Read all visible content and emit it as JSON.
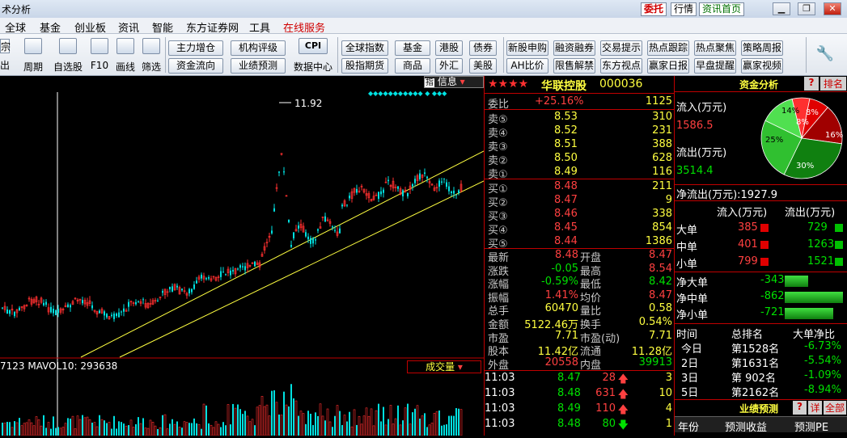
{
  "window": {
    "title": "术分析",
    "btn_trade": "委托",
    "btn_info": "行情",
    "btn_home": "资讯首页"
  },
  "menu": [
    "全球",
    "基金",
    "创业板",
    "资讯",
    "智能",
    "东方证券网",
    "工具",
    "在线服务"
  ],
  "toolbar": {
    "left_edge": [
      "宗",
      "出"
    ],
    "icons": [
      "周期",
      "自选股",
      "F10",
      "画线",
      "筛选"
    ],
    "group1": [
      "主力增仓",
      "资金流向",
      "机构评级",
      "业绩预测"
    ],
    "cpi": "CPI",
    "cpi_label": "数据中心",
    "group2": [
      "全球指数",
      "股指期货",
      "基金",
      "商品",
      "港股",
      "外汇",
      "债券",
      "美股"
    ],
    "group3": [
      "新股申购",
      "融资融券",
      "交易提示",
      "热点跟踪",
      "热点聚焦",
      "策略周报",
      "AH比价",
      "限售解禁",
      "东方视点",
      "赢家日报",
      "早盘提醒",
      "赢家视频"
    ]
  },
  "chart": {
    "peak_label": "11.92",
    "info_btn": "信息",
    "vol_label": "7123  MAVOL10: 293638",
    "vol_btn": "成交量"
  },
  "quote": {
    "stars": "★★★★",
    "name": "华联控股",
    "code": "000036",
    "weibi": {
      "label": "委比",
      "pct": "+25.16%",
      "val": "1125"
    },
    "sell": [
      {
        "l": "卖⑤",
        "p": "8.53",
        "v": "310"
      },
      {
        "l": "卖④",
        "p": "8.52",
        "v": "231"
      },
      {
        "l": "卖③",
        "p": "8.51",
        "v": "388"
      },
      {
        "l": "卖②",
        "p": "8.50",
        "v": "628"
      },
      {
        "l": "卖①",
        "p": "8.49",
        "v": "116"
      }
    ],
    "buy": [
      {
        "l": "买①",
        "p": "8.48",
        "v": "211"
      },
      {
        "l": "买②",
        "p": "8.47",
        "v": "9"
      },
      {
        "l": "买③",
        "p": "8.46",
        "v": "338"
      },
      {
        "l": "买④",
        "p": "8.45",
        "v": "854"
      },
      {
        "l": "买⑤",
        "p": "8.44",
        "v": "1386"
      }
    ],
    "stats": [
      {
        "l1": "最新",
        "v1": "8.48",
        "l2": "开盘",
        "v2": "8.47"
      },
      {
        "l1": "涨跌",
        "v1": "-0.05",
        "l2": "最高",
        "v2": "8.54"
      },
      {
        "l1": "涨幅",
        "v1": "-0.59%",
        "l2": "最低",
        "v2": "8.42"
      },
      {
        "l1": "振幅",
        "v1": "1.41%",
        "l2": "均价",
        "v2": "8.47"
      },
      {
        "l1": "总手",
        "v1": "60470",
        "l2": "量比",
        "v2": "0.58"
      },
      {
        "l1": "金额",
        "v1": "5122.46万",
        "l2": "换手",
        "v2": "0.54%"
      },
      {
        "l1": "市盈",
        "v1": "7.71",
        "l2": "市盈(动)",
        "v2": "7.71"
      },
      {
        "l1": "股本",
        "v1": "11.42亿",
        "l2": "流通",
        "v2": "11.28亿"
      },
      {
        "l1": "外盘",
        "v1": "20558",
        "l2": "内盘",
        "v2": "39913"
      }
    ],
    "ticks": [
      {
        "t": "11:03",
        "p": "8.47",
        "v": "28",
        "dir": "up",
        "n": "3"
      },
      {
        "t": "11:03",
        "p": "8.48",
        "v": "631",
        "dir": "up",
        "n": "10"
      },
      {
        "t": "11:03",
        "p": "8.49",
        "v": "110",
        "dir": "up",
        "n": "4"
      },
      {
        "t": "11:03",
        "p": "8.48",
        "v": "80",
        "dir": "down",
        "n": "1"
      }
    ]
  },
  "fund": {
    "title": "资金分析",
    "btn_q": "?",
    "btn_rank": "排名",
    "inflow_label": "流入(万元)",
    "inflow": "1586.5",
    "outflow_label": "流出(万元)",
    "outflow": "3514.4",
    "net_label": "净流出(万元):",
    "net": "1927.9",
    "pie": [
      {
        "pct": 8,
        "color": "#e00000"
      },
      {
        "pct": 16,
        "color": "#a00000"
      },
      {
        "pct": 30,
        "color": "#108010"
      },
      {
        "pct": 25,
        "color": "#30c030"
      },
      {
        "pct": 14,
        "color": "#50e050"
      },
      {
        "pct": 7,
        "color": "#ff3030"
      }
    ],
    "pie_labels": [
      "8%",
      "16%",
      "30%",
      "25%",
      "14%",
      "8%"
    ],
    "col_in": "流入(万元)",
    "col_out": "流出(万元)",
    "orders": [
      {
        "l": "大单",
        "in": "385",
        "out": "729"
      },
      {
        "l": "中单",
        "in": "401",
        "out": "1263"
      },
      {
        "l": "小单",
        "in": "799",
        "out": "1521"
      }
    ],
    "net_orders": [
      {
        "l": "净大单",
        "v": "-343",
        "w": 0.4
      },
      {
        "l": "净中单",
        "v": "-862",
        "w": 1.0
      },
      {
        "l": "净小单",
        "v": "-721",
        "w": 0.84
      }
    ],
    "rank_head": [
      "时间",
      "总排名",
      "大单净比"
    ],
    "rank": [
      {
        "d": "今日",
        "r": "第1528名",
        "p": "-6.73%"
      },
      {
        "d": "2日",
        "r": "第1631名",
        "p": "-5.54%"
      },
      {
        "d": "3日",
        "r": "第 902名",
        "p": "-1.09%"
      },
      {
        "d": "5日",
        "r": "第2162名",
        "p": "-8.94%"
      }
    ],
    "perf_title": "业绩预测",
    "perf_btns": [
      "?",
      "详",
      "全部"
    ],
    "perf_cols": [
      "年份",
      "预测收益",
      "预测PE"
    ]
  }
}
